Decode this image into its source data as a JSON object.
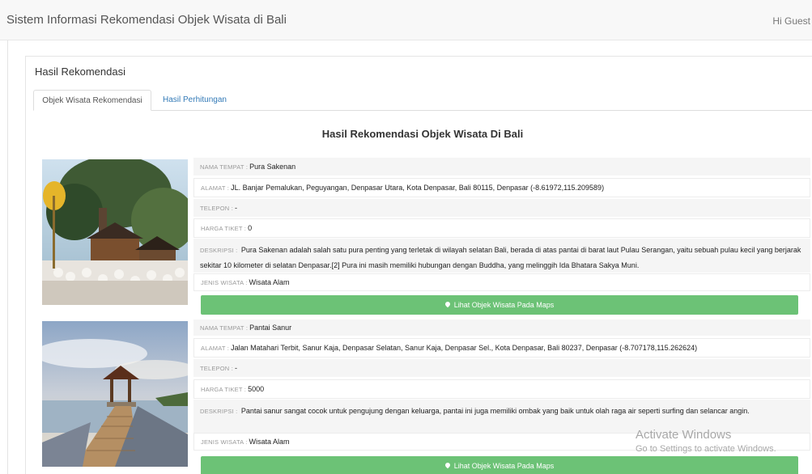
{
  "header": {
    "title": "Sistem Informasi Rekomendasi Objek Wisata di Bali",
    "greeting": "Hi Guest"
  },
  "panel": {
    "title": "Hasil Rekomendasi"
  },
  "tabs": [
    {
      "label": "Objek Wisata Rekomendasi"
    },
    {
      "label": "Hasil Perhitungan"
    }
  ],
  "content": {
    "heading": "Hasil Rekomendasi Objek Wisata Di Bali"
  },
  "labels": {
    "nama": "NAMA TEMPAT :",
    "alamat": "ALAMAT :",
    "telepon": "TELEPON :",
    "harga": "HARGA TIKET :",
    "deskripsi": "DESKRIPSI :",
    "jenis": "JENIS WISATA :"
  },
  "results": [
    {
      "nama": "Pura Sakenan",
      "alamat": "JL. Banjar Pemalukan, Peguyangan, Denpasar Utara, Kota Denpasar, Bali 80115, Denpasar (-8.61972,115.209589)",
      "telepon": "-",
      "harga": "0",
      "deskripsi": "Pura Sakenan adalah salah satu pura penting yang terletak di wilayah selatan Bali, berada di atas pantai di barat laut Pulau Serangan, yaitu sebuah pulau kecil yang berjarak sekitar 10 kilometer di selatan Denpasar.[2] Pura ini masih memiliki hubungan dengan Buddha, yang melinggih Ida Bhatara Sakya Muni.",
      "jenis": "Wisata Alam",
      "button": "Lihat Objek Wisata Pada Maps"
    },
    {
      "nama": "Pantai Sanur",
      "alamat": "Jalan Matahari Terbit, Sanur Kaja, Denpasar Selatan, Sanur Kaja, Denpasar Sel., Kota Denpasar, Bali 80237, Denpasar (-8.707178,115.262624)",
      "telepon": "-",
      "harga": "5000",
      "deskripsi": "Pantai sanur sangat cocok untuk pengujung dengan keluarga, pantai ini juga memiliki ombak yang baik untuk olah raga air seperti surfing dan selancar angin.",
      "jenis": "Wisata Alam",
      "button": "Lihat Objek Wisata Pada Maps"
    }
  ],
  "watermark": {
    "line1": "Activate Windows",
    "line2": "Go to Settings to activate Windows."
  }
}
